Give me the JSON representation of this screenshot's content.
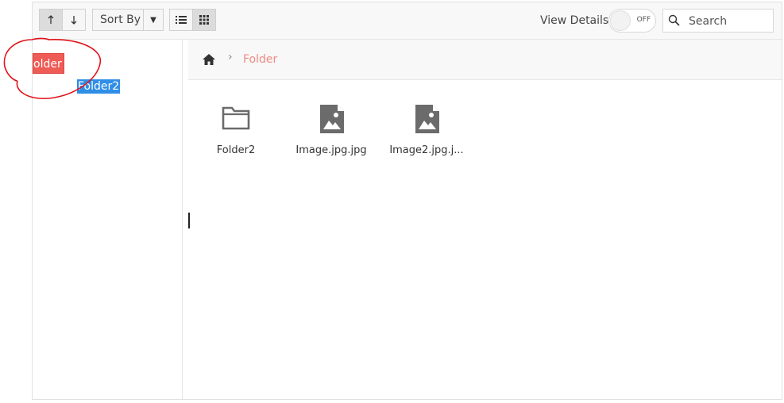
{
  "toolbar": {
    "sort_by_label": "Sort By",
    "view_details_label": "View Details",
    "toggle_label": "OFF",
    "search_placeholder": "Search"
  },
  "tree": {
    "folder_label": "older",
    "folder2_label": "Folder2"
  },
  "breadcrumb": {
    "current": "Folder"
  },
  "files": [
    {
      "name": "Folder2",
      "type": "folder-icon"
    },
    {
      "name": "Image.jpg.jpg",
      "type": "image-file-icon"
    },
    {
      "name": "Image2.jpg.j...",
      "type": "image-file-icon"
    }
  ],
  "colors": {
    "accent_red": "#ef5b55",
    "selection_blue": "#2f8ee6",
    "breadcrumb_text": "#f08a84",
    "annotation_red": "#e0121a"
  }
}
